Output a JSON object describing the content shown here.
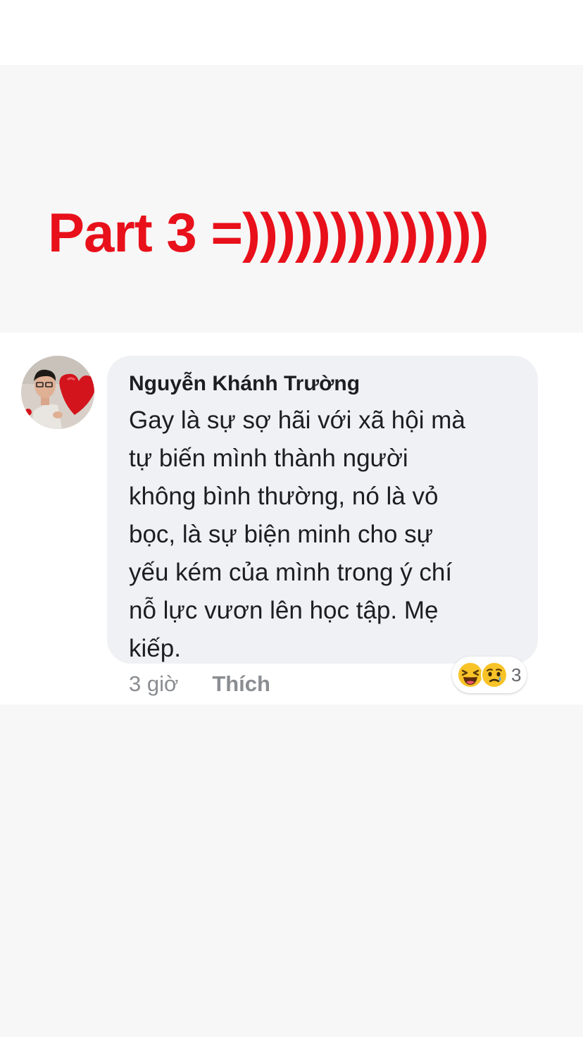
{
  "caption": {
    "text": "Part 3 =))))))))))))))",
    "color": "#e8101a"
  },
  "comment": {
    "author": "Nguyễn Khánh Trường",
    "body_lines": [
      "Gay là sự sợ hãi với xã hội mà",
      "tự biến mình thành người",
      "không bình thường, nó là vỏ",
      "bọc, là sự biện minh cho sự",
      "yếu kém của mình trong ý chí",
      "nỗ lực vươn lên học tập. Mẹ",
      "kiếp."
    ],
    "time": "3 giờ",
    "like_label": "Thích",
    "reactions": {
      "icons": [
        "haha-reaction-icon",
        "sad-reaction-icon"
      ],
      "count": "3"
    }
  }
}
